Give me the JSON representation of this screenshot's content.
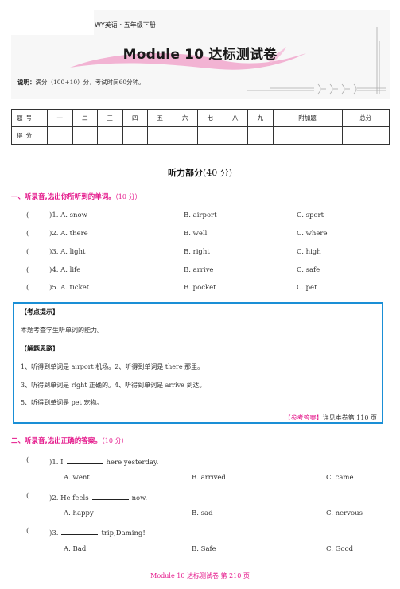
{
  "header": {
    "series": "WY英语・五年级下册",
    "title": "Module 10  达标测试卷",
    "instructions_label": "说明：",
    "instructions_text": "满分（100+10）分，考试时间60分钟。"
  },
  "score_table": {
    "row1_label": "题号",
    "columns": [
      "一",
      "二",
      "三",
      "四",
      "五",
      "六",
      "七",
      "八",
      "九",
      "附加题",
      "总分"
    ],
    "row2_label": "得分"
  },
  "section": {
    "title": "听力部分",
    "points": "(40 分)"
  },
  "part1": {
    "heading": "一、听录音,选出你所听到的单词。",
    "points": "（10 分）",
    "items": [
      {
        "num": ")1. A. snow",
        "b": "B. airport",
        "c": "C. sport"
      },
      {
        "num": ")2. A. there",
        "b": "B. well",
        "c": "C. where"
      },
      {
        "num": ")3. A. light",
        "b": "B. right",
        "c": "C. high"
      },
      {
        "num": ")4. A. life",
        "b": "B. arrive",
        "c": "C. safe"
      },
      {
        "num": ")5. A. ticket",
        "b": "B. pocket",
        "c": "C. pet"
      }
    ],
    "paren_open": "("
  },
  "tips": {
    "label1": "【考点提示】",
    "text1": "本题考查学生听单词的能力。",
    "label2": "【解题思路】",
    "lines": [
      "1、听得到单词是 airport 机场。2、听得到单词是 there 那里。",
      "3、听得到单词是 right 正确的。4、听得到单词是 arrive 到达。",
      "5、听得到单词是 pet 宠物。"
    ],
    "ref_label": "【参考答案】",
    "ref_text": "详见本卷第 110 页"
  },
  "part2": {
    "heading": "二、听录音,选出正确的答案。",
    "points": "（10 分）",
    "paren_open": "(",
    "items": [
      {
        "pre": ")1. I",
        "post": "here yesterday.",
        "a": "A. went",
        "b": "B. arrived",
        "c": "C. came"
      },
      {
        "pre": ")2. He feels",
        "post": "now.",
        "a": "A. happy",
        "b": "B. sad",
        "c": "C. nervous"
      },
      {
        "pre": ")3.",
        "post": "trip,Daming!",
        "a": "A. Bad",
        "b": "B. Safe",
        "c": "C. Good"
      }
    ]
  },
  "footer": {
    "text": "Module 10   达标测试卷   第 210 页"
  },
  "colors": {
    "accent_pink": "#e4168a",
    "box_blue": "#1a8fd6"
  }
}
